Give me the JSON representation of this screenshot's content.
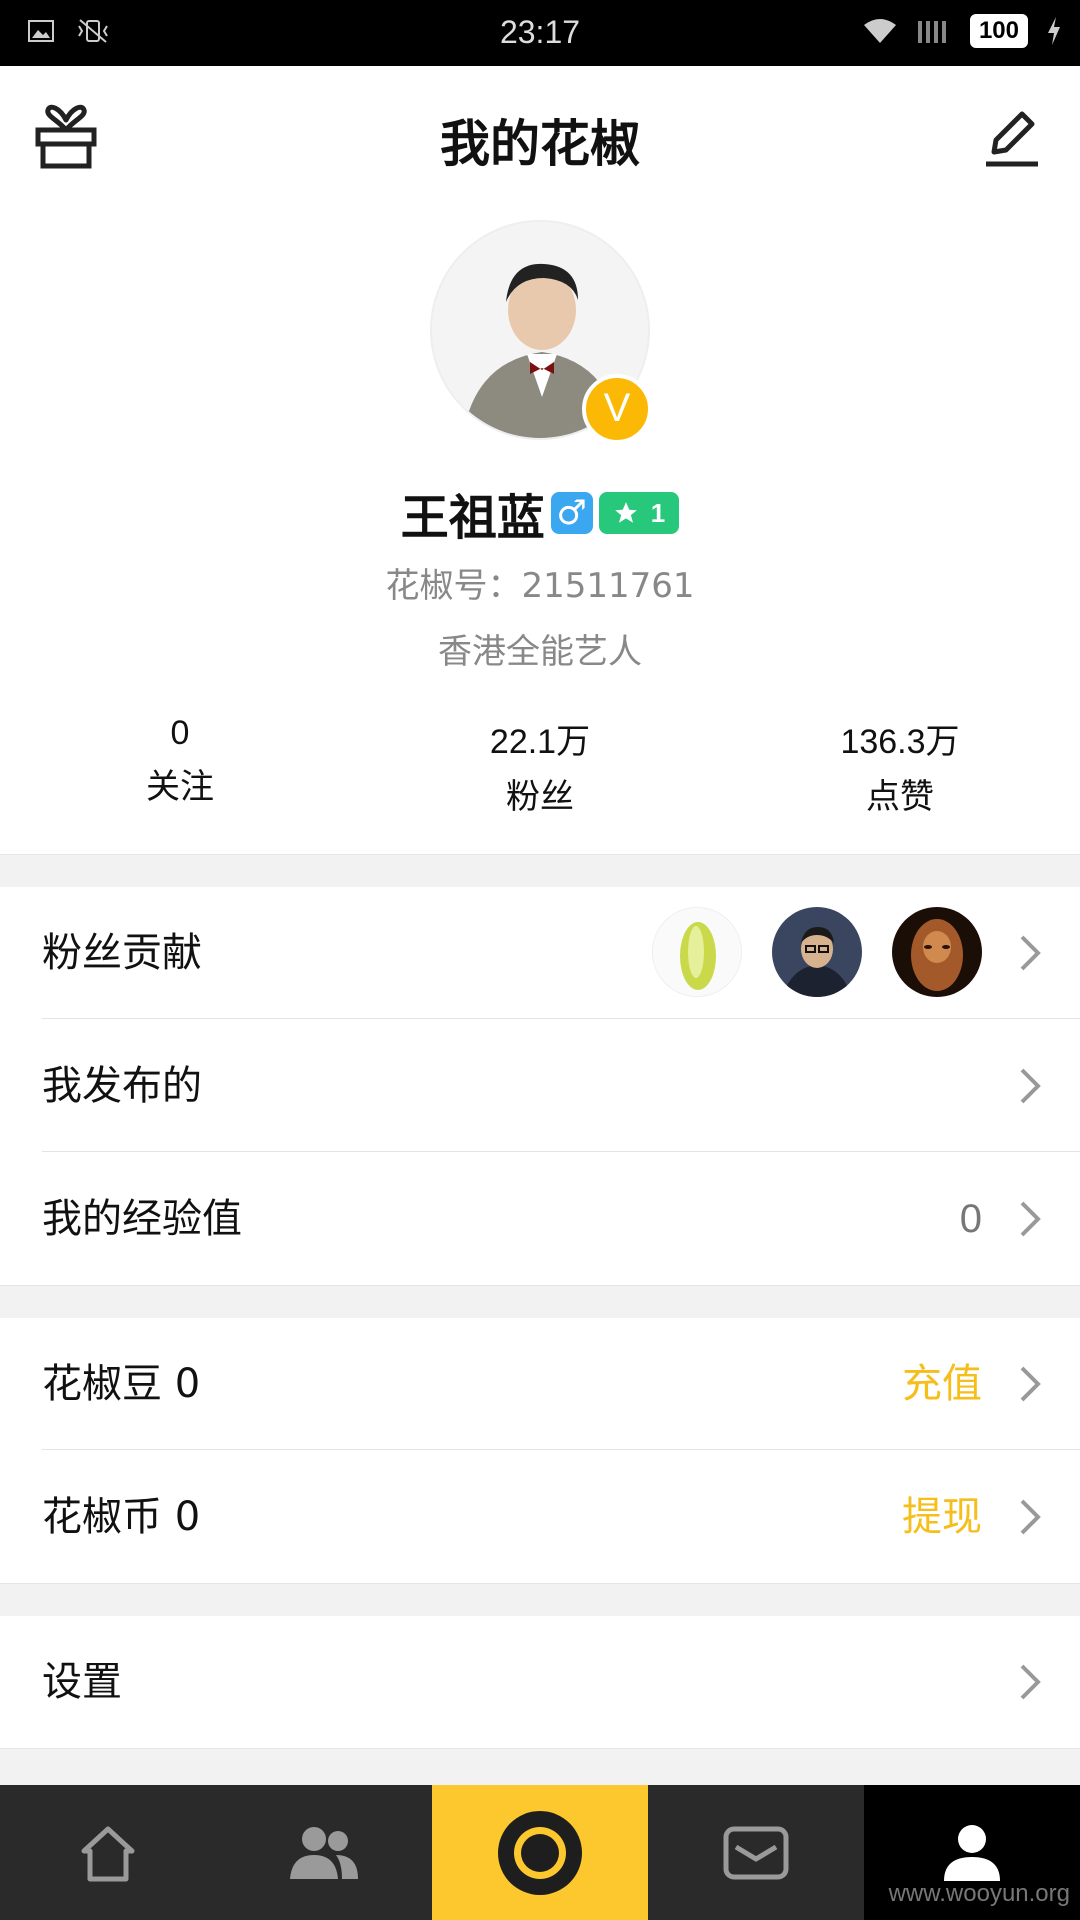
{
  "status_bar": {
    "time": "23:17",
    "battery": "100",
    "icons": [
      "image-icon",
      "vibrate-off-icon",
      "wifi-icon",
      "signal-icon",
      "charging-icon"
    ]
  },
  "header": {
    "title": "我的花椒",
    "left_icon": "gift-icon",
    "right_icon": "edit-icon"
  },
  "profile": {
    "name": "王祖蓝",
    "gender_symbol": "♂",
    "verified_badge": "V",
    "level": "1",
    "id_label": "花椒号：21511761",
    "bio": "香港全能艺人"
  },
  "stats": [
    {
      "value": "0",
      "label": "关注"
    },
    {
      "value": "22.1万",
      "label": "粉丝"
    },
    {
      "value": "136.3万",
      "label": "点赞"
    }
  ],
  "menu": {
    "fan_contribution": "粉丝贡献",
    "my_posts": "我发布的",
    "my_exp": "我的经验值",
    "my_exp_value": "0",
    "beans": "花椒豆 0",
    "beans_action": "充值",
    "coins": "花椒币 0",
    "coins_action": "提现",
    "settings": "设置"
  },
  "tabbar": {
    "items": [
      "home-icon",
      "friends-icon",
      "live-camera-icon",
      "messages-icon",
      "profile-icon"
    ],
    "active": "profile-icon"
  },
  "watermark": "www.wooyun.org",
  "colors": {
    "accent_yellow": "#fdc82e",
    "action_yellow": "#f5be1a",
    "level_green": "#27c77c",
    "gender_blue": "#3aa7f0",
    "tabbar_bg": "#2a2a2a"
  }
}
